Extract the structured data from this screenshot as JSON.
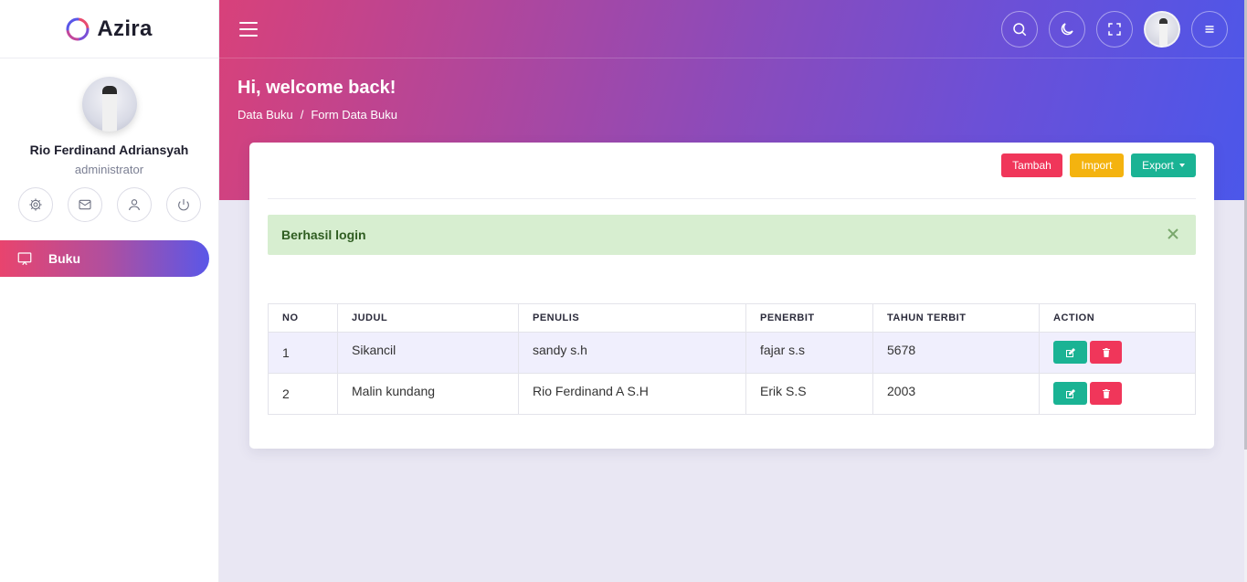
{
  "app": {
    "brand": "Azira"
  },
  "sidebar": {
    "user_name": "Rio Ferdinand Adriansyah",
    "user_role": "administrator",
    "quick_icons": [
      "gear-icon",
      "mail-icon",
      "user-icon",
      "power-icon"
    ],
    "nav": [
      {
        "label": "Buku",
        "icon": "monitor-icon",
        "active": true
      }
    ]
  },
  "header": {
    "welcome": "Hi, welcome back!",
    "breadcrumb": [
      "Data Buku",
      "/",
      "Form Data Buku"
    ],
    "icons": [
      "search-icon",
      "moon-icon",
      "fullscreen-icon",
      "avatar",
      "menu-icon"
    ]
  },
  "toolbar": {
    "tambah": "Tambah",
    "import": "Import",
    "export": "Export"
  },
  "alert": {
    "text": "Berhasil login"
  },
  "table": {
    "headers": [
      "NO",
      "JUDUL",
      "PENULIS",
      "PENERBIT",
      "TAHUN TERBIT",
      "ACTION"
    ],
    "rows": [
      {
        "no": "1",
        "judul": "Sikancil",
        "penulis": "sandy s.h",
        "penerbit": "fajar s.s",
        "tahun": "5678"
      },
      {
        "no": "2",
        "judul": "Malin kundang",
        "penulis": "Rio Ferdinand A S.H",
        "penerbit": "Erik S.S",
        "tahun": "2003"
      }
    ]
  },
  "colors": {
    "primary_gradient_start": "#d8417a",
    "primary_gradient_end": "#4b57ea",
    "danger": "#f0365a",
    "warning": "#f4b30f",
    "success": "#1ab394"
  }
}
